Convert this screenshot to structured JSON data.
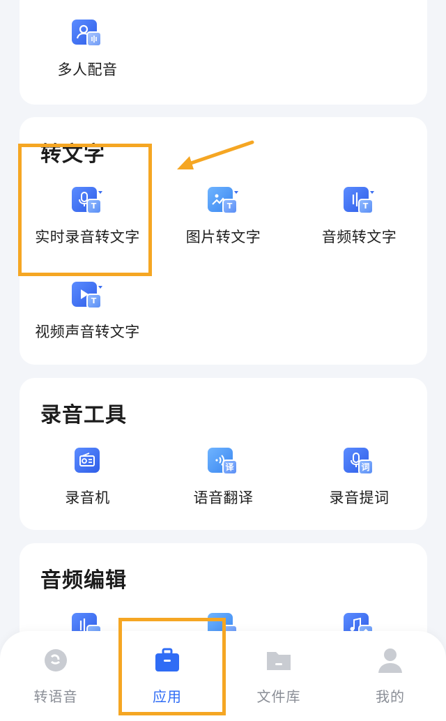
{
  "top_card": {
    "items": [
      {
        "label": "多人配音",
        "icon": "multi-voice-icon"
      }
    ]
  },
  "to_text": {
    "title": "转文字",
    "items": [
      {
        "label": "实时录音转文字",
        "icon": "mic-to-text-icon",
        "badge": "T"
      },
      {
        "label": "图片转文字",
        "icon": "image-to-text-icon",
        "badge": "T"
      },
      {
        "label": "音频转文字",
        "icon": "audio-to-text-icon",
        "badge": "T"
      },
      {
        "label": "视频声音转文字",
        "icon": "video-to-text-icon",
        "badge": "T"
      }
    ]
  },
  "record_tools": {
    "title": "录音工具",
    "items": [
      {
        "label": "录音机",
        "icon": "radio-recorder-icon"
      },
      {
        "label": "语音翻译",
        "icon": "voice-translate-icon",
        "badge": "译"
      },
      {
        "label": "录音提词",
        "icon": "teleprompter-icon",
        "badge": "词"
      }
    ]
  },
  "audio_edit": {
    "title": "音频编辑",
    "items": [
      {
        "icon": "audio-cut-icon"
      },
      {
        "icon": "audio-convert-icon"
      },
      {
        "icon": "music-extract-icon"
      }
    ]
  },
  "bottom_nav": {
    "items": [
      {
        "label": "转语音",
        "icon": "voice-tab-icon",
        "active": false
      },
      {
        "label": "应用",
        "icon": "briefcase-icon",
        "active": true
      },
      {
        "label": "文件库",
        "icon": "folder-icon",
        "active": false
      },
      {
        "label": "我的",
        "icon": "user-icon",
        "active": false
      }
    ]
  },
  "colors": {
    "accent": "#2f6cf5",
    "annotation": "#f5a623",
    "background": "#f3f5f9"
  }
}
